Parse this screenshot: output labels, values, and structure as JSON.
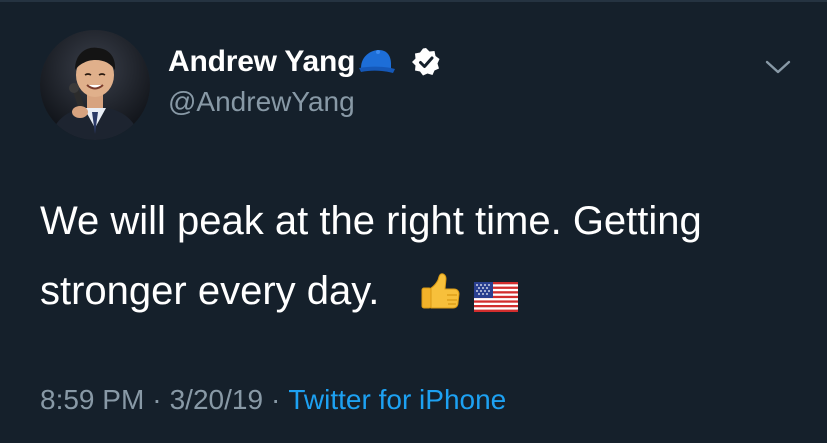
{
  "tweet": {
    "author": {
      "display_name": "Andrew Yang",
      "handle": "@AndrewYang",
      "name_emoji": "blue-cap-icon",
      "verified_icon": "verified-badge-icon"
    },
    "text_line_1": "We will peak at the right time.  Getting",
    "text_line_2": "stronger every day.",
    "emojis": [
      "thumbs-up-icon",
      "us-flag-icon"
    ],
    "time": "8:59 PM",
    "separator": "·",
    "date": "3/20/19",
    "source": "Twitter for iPhone",
    "menu_icon": "chevron-down-icon"
  },
  "colors": {
    "background": "#15202b",
    "primary_text": "#ffffff",
    "secondary_text": "#8899a6",
    "link": "#1da1f2",
    "verified": "#ffffff",
    "cap": "#1d6ed8"
  }
}
